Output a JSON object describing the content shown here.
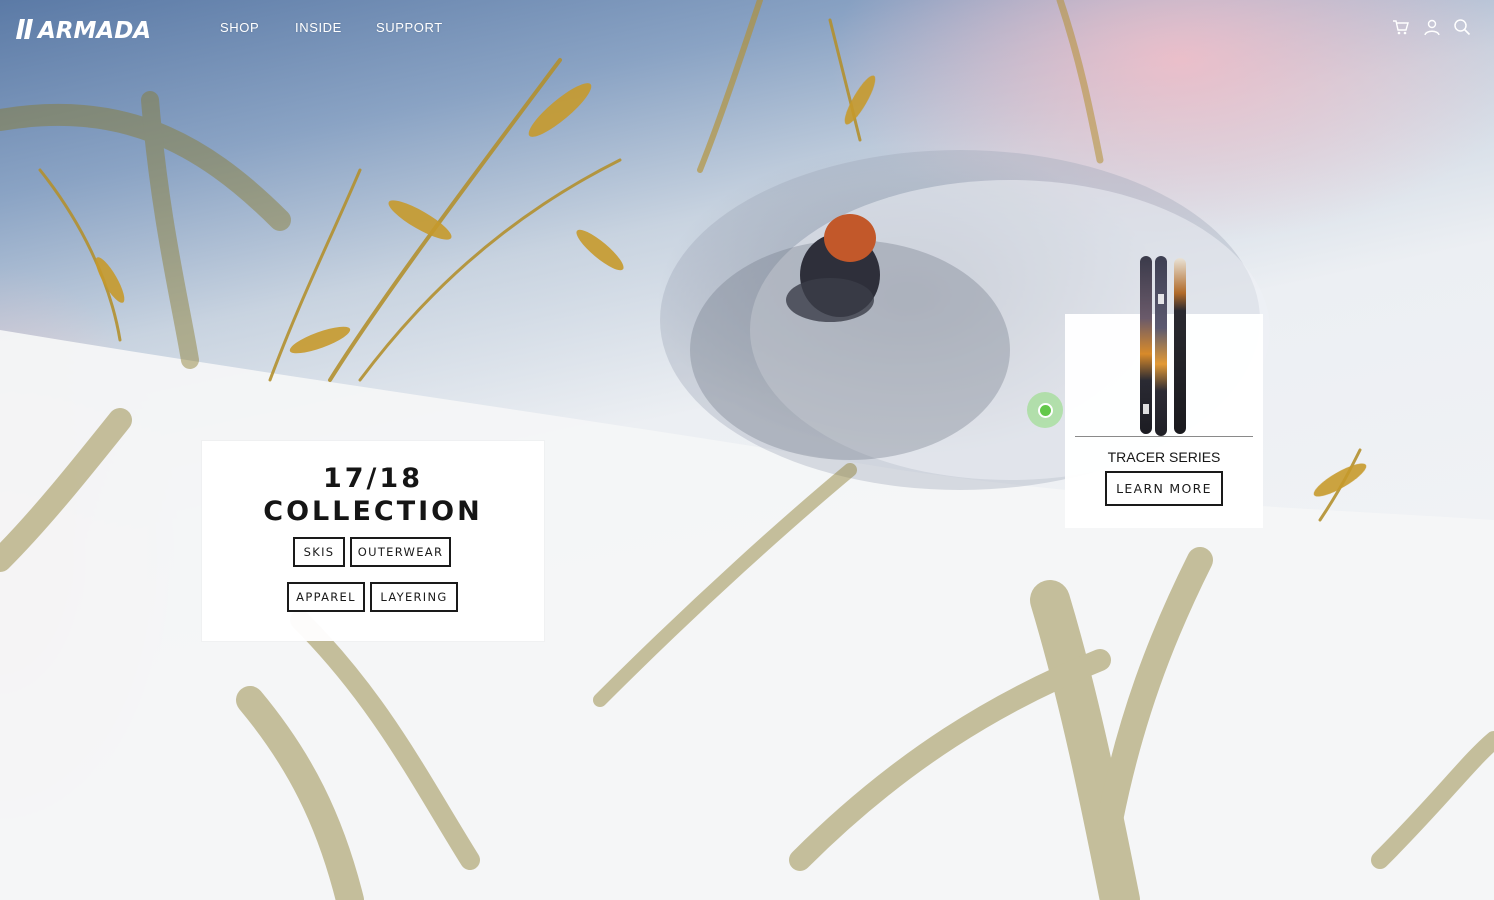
{
  "brand": {
    "logo_text": "ARMADA"
  },
  "nav": {
    "links": [
      {
        "label": "SHOP"
      },
      {
        "label": "INSIDE"
      },
      {
        "label": "SUPPORT"
      }
    ],
    "icons": [
      "cart-icon",
      "account-icon",
      "search-icon"
    ]
  },
  "collection": {
    "year": "17/18",
    "title": "COLLECTION",
    "buttons": [
      {
        "label": "SKIS"
      },
      {
        "label": "OUTERWEAR"
      },
      {
        "label": "APPAREL"
      },
      {
        "label": "LAYERING"
      }
    ]
  },
  "product": {
    "name": "TRACER SERIES",
    "cta": "LEARN MORE"
  },
  "colors": {
    "hotspot": "#63c84a",
    "text": "#151515",
    "card": "#ffffff"
  }
}
